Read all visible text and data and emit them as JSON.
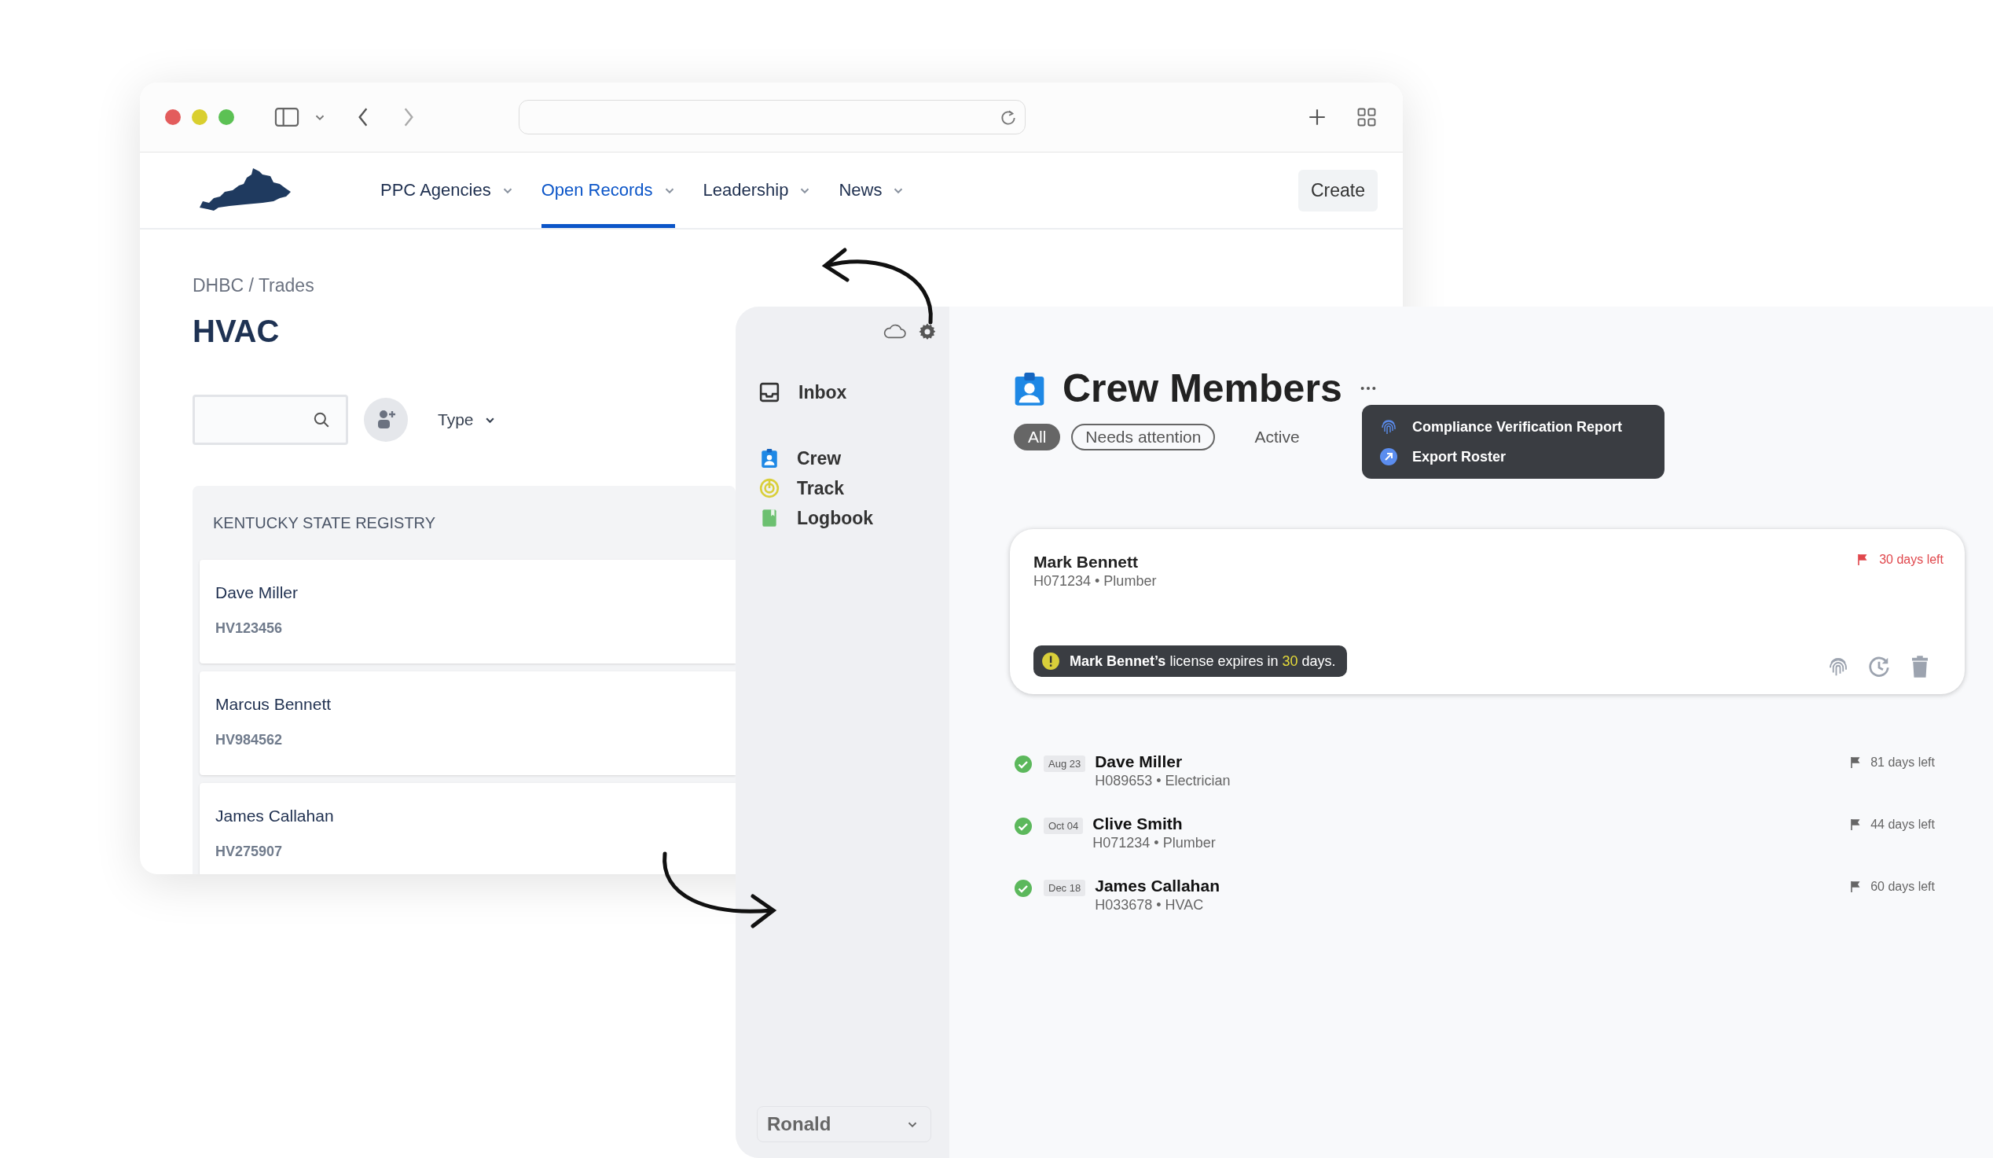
{
  "browser": {
    "nav": [
      {
        "label": "PPC Agencies",
        "selected": false
      },
      {
        "label": "Open Records",
        "selected": true
      },
      {
        "label": "Leadership",
        "selected": false
      },
      {
        "label": "News",
        "selected": false
      }
    ],
    "create_button": "Create",
    "breadcrumb": "DHBC / Trades",
    "title": "HVAC",
    "filter": "Type",
    "registry": {
      "heading": "KENTUCKY STATE REGISTRY",
      "entries": [
        {
          "name": "Dave Miller",
          "id": "HV123456"
        },
        {
          "name": "Marcus Bennett",
          "id": "HV984562"
        },
        {
          "name": "James Callahan",
          "id": "HV275907"
        }
      ]
    }
  },
  "app": {
    "sidebar": {
      "items": [
        {
          "label": "Inbox",
          "kind": "inbox"
        },
        {
          "label": "Crew",
          "kind": "crew"
        },
        {
          "label": "Track",
          "kind": "track"
        },
        {
          "label": "Logbook",
          "kind": "logbook"
        }
      ],
      "user": "Ronald"
    },
    "title": "Crew Members",
    "filters": [
      {
        "label": "All",
        "kind": "pill",
        "selected": true
      },
      {
        "label": "Needs attention",
        "kind": "pill",
        "selected": false
      },
      {
        "label": "Active",
        "kind": "text",
        "selected": false
      }
    ],
    "menu": [
      {
        "label": "Compliance Verification Report",
        "kind": "fingerprint"
      },
      {
        "label": "Export Roster",
        "kind": "export"
      }
    ],
    "featured": {
      "name": "Mark Bennett",
      "sub": "H071234 • Plumber",
      "due": "30 days left",
      "urgent": true,
      "alert": {
        "before": "**Mark Bennet’s** license expires in ",
        "highlight": "30",
        "after": " days."
      }
    },
    "members": [
      {
        "date": "Aug 23",
        "name": "Dave Miller",
        "sub": "H089653 • Electrician",
        "due": "81 days left",
        "verified": true
      },
      {
        "date": "Oct 04",
        "name": "Clive Smith",
        "sub": "H071234 • Plumber",
        "due": "44 days left",
        "verified": true
      },
      {
        "date": "Dec 18",
        "name": "James Callahan",
        "sub": "H033678 • HVAC",
        "due": "60 days left",
        "verified": true
      }
    ]
  }
}
